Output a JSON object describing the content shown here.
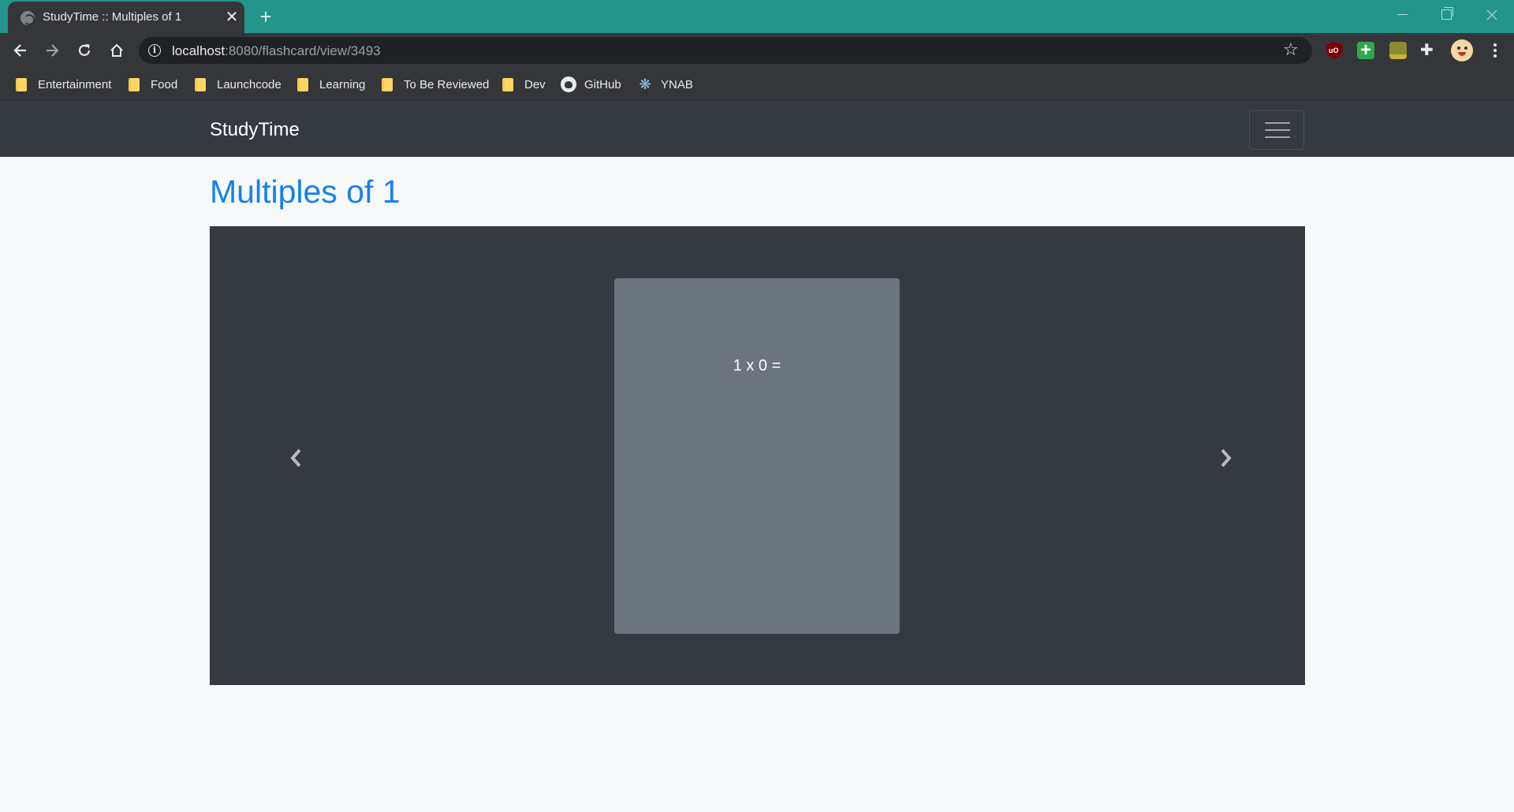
{
  "browser": {
    "tab_title": "StudyTime :: Multiples of 1",
    "tab_close_glyph": "✕",
    "new_tab_glyph": "+",
    "url_host": "localhost",
    "url_path": ":8080/flashcard/view/3493",
    "star_glyph": "☆",
    "puzzle_glyph": "✚",
    "bookmarks": [
      {
        "label": "Entertainment",
        "icon": "folder-icon"
      },
      {
        "label": "Food",
        "icon": "folder-icon"
      },
      {
        "label": "Launchcode",
        "icon": "folder-icon"
      },
      {
        "label": "Learning",
        "icon": "folder-icon"
      },
      {
        "label": "To Be Reviewed",
        "icon": "folder-icon"
      },
      {
        "label": "Dev",
        "icon": "folder-icon"
      },
      {
        "label": "GitHub",
        "icon": "github-icon"
      },
      {
        "label": "YNAB",
        "icon": "ynab-tree-icon"
      }
    ],
    "colors": {
      "frame": "#23958a",
      "toolbar": "#35363a",
      "omnibox": "#202124"
    }
  },
  "navbar": {
    "brand": "StudyTime",
    "colors": {
      "background": "#343a40"
    }
  },
  "main": {
    "title": "Multiples of 1",
    "card_text": "1 x 0 =",
    "colors": {
      "title": "#1680f0",
      "carousel": "#343a40",
      "card": "#6c757d",
      "page": "#f8f9fa"
    }
  }
}
